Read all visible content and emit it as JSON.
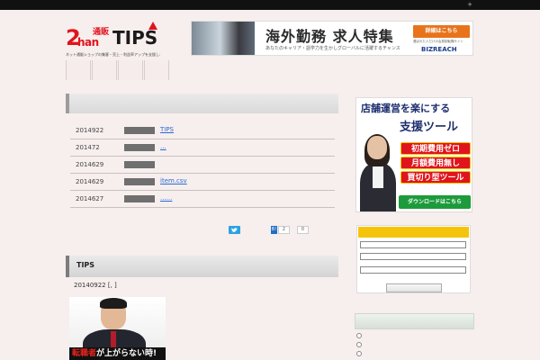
{
  "topbar": {
    "plus_icon": "+"
  },
  "logo": {
    "two": "2",
    "han": "han",
    "tsuhan": "通販",
    "tips": "TIPS",
    "tagline": "ネット通販ショップの集客・売上・利益率アップを支援します"
  },
  "top_banner": {
    "main": "海外勤務 求人特集",
    "sub": "あなたのキャリア・語学力を生かしグローバルに活躍するチャンス",
    "cta": "詳細はこちら",
    "small": "選ばれた人だけの会員制転職サイト",
    "brand": "BIZREACH"
  },
  "nav": {
    "items": [
      "",
      "",
      "",
      ""
    ]
  },
  "news": [
    {
      "date": "2014922",
      "title": "TIPS"
    },
    {
      "date": "201472",
      "title": "..."
    },
    {
      "date": "2014629",
      "title": ""
    },
    {
      "date": "2014629",
      "title": "item.csv"
    },
    {
      "date": "2014627",
      "title": "......"
    }
  ],
  "social": {
    "hatena_icon": "B!",
    "hatena_count": "2",
    "other_count": "0"
  },
  "section2": {
    "title": "TIPS",
    "meta": "20140922 [, ]",
    "image_caption_red": "転職者",
    "image_caption_white": "が上がらない時!"
  },
  "side_ad": {
    "line1": "店舗運営を楽にする",
    "line2": "支援ツール",
    "badges": [
      "初期費用ゼロ",
      "月額費用無し",
      "買切り型ツール"
    ],
    "download": "ダウンロードはこちら"
  },
  "colors": {
    "accent_red": "#e0141c",
    "link_blue": "#2a6ad4",
    "widget_yellow": "#f5c40a",
    "download_green": "#1d9b3c"
  }
}
